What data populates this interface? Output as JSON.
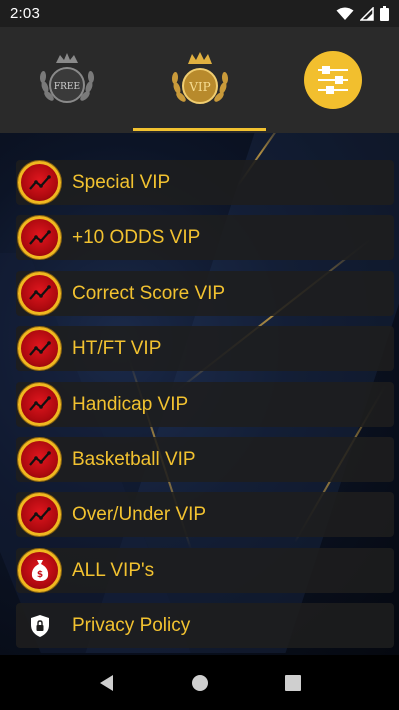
{
  "status": {
    "time": "2:03"
  },
  "tabs": [
    {
      "label": "FREE",
      "icon": "free-laurel-badge-icon"
    },
    {
      "label": "VIP",
      "icon": "vip-crown-badge-icon",
      "selected": true
    },
    {
      "label": "",
      "icon": "settings-sliders-icon"
    }
  ],
  "menu": {
    "items": [
      {
        "label": "Special VIP",
        "icon": "trend-chart-icon"
      },
      {
        "label": "+10 ODDS VIP",
        "icon": "trend-chart-icon"
      },
      {
        "label": "Correct Score VIP",
        "icon": "trend-chart-icon"
      },
      {
        "label": "HT/FT VIP",
        "icon": "trend-chart-icon"
      },
      {
        "label": "Handicap VIP",
        "icon": "trend-chart-icon"
      },
      {
        "label": "Basketball VIP",
        "icon": "trend-chart-icon"
      },
      {
        "label": "Over/Under VIP",
        "icon": "trend-chart-icon"
      },
      {
        "label": "ALL VIP's",
        "icon": "money-bag-icon"
      },
      {
        "label": "Privacy Policy",
        "icon": "shield-lock-icon"
      }
    ]
  },
  "colors": {
    "accent": "#f2c230",
    "item_bg": "#1e1e1e",
    "badge_red": "#d4141c"
  }
}
